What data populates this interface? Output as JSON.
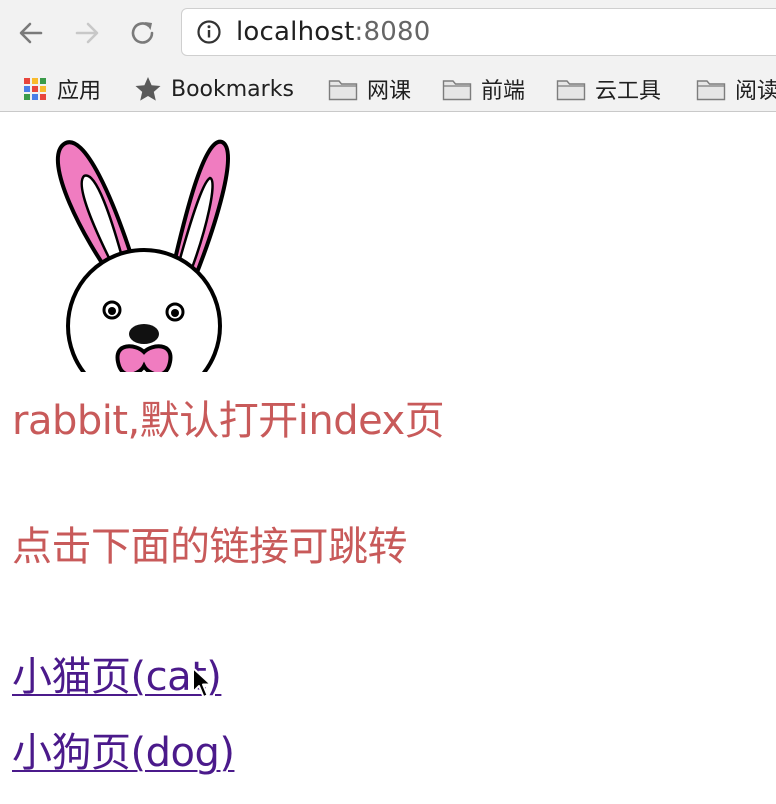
{
  "browser": {
    "url_host": "localhost",
    "url_port": ":8080",
    "icons": {
      "back": "arrow-left-icon",
      "forward": "arrow-right-icon",
      "reload": "reload-icon",
      "site_info": "info-icon"
    }
  },
  "bookmarks_bar": {
    "apps_label": "应用",
    "bookmarks_label": "Bookmarks",
    "folders": [
      "网课",
      "前端",
      "云工具",
      "阅读"
    ]
  },
  "page": {
    "headline": "rabbit,默认打开index页",
    "subheadline": "点击下面的链接可跳转",
    "links": {
      "cat": "小猫页(cat)",
      "dog": "小狗页(dog)"
    },
    "colors": {
      "headline": "#c85a5a",
      "link": "#4b1a8b",
      "rabbit_ear": "#f07cc0"
    }
  }
}
